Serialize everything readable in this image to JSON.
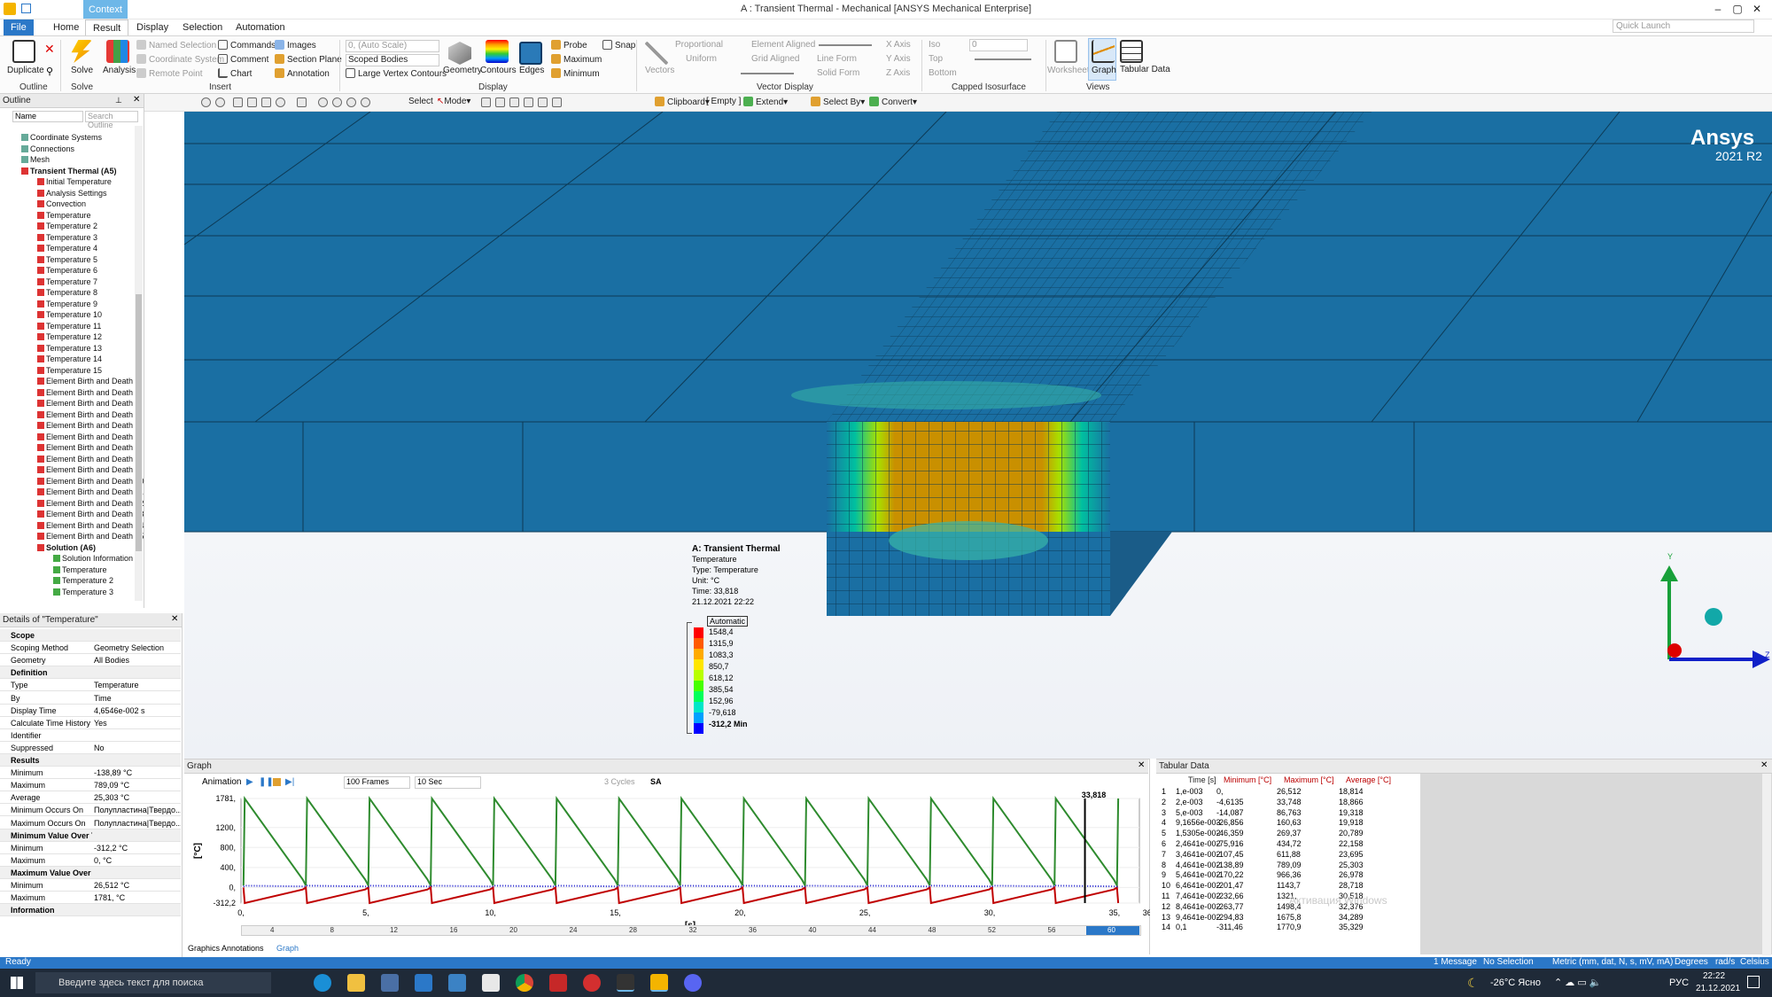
{
  "window": {
    "title": "A : Transient Thermal - Mechanical [ANSYS Mechanical Enterprise]",
    "context_tab": "Context",
    "quick_launch": "Quick Launch"
  },
  "ribbon": {
    "tabs": [
      "File",
      "Home",
      "Result",
      "Display",
      "Selection",
      "Automation"
    ],
    "groups": {
      "outline": "Outline",
      "solve": "Solve",
      "insert": "Insert",
      "display": "Display",
      "vector_display": "Vector Display",
      "capped_isosurface": "Capped Isosurface",
      "views": "Views"
    },
    "buttons": {
      "duplicate": "Duplicate",
      "solve": "Solve",
      "analysis": "Analysis",
      "named_selection": "Named Selection",
      "coordinate_system": "Coordinate System",
      "remote_point": "Remote Point",
      "commands": "Commands",
      "comment": "Comment",
      "chart": "Chart",
      "images": "Images",
      "section_plane": "Section Plane",
      "annotation": "Annotation",
      "auto_scale": "0, (Auto Scale)",
      "scoped_bodies": "Scoped Bodies",
      "large_vertex": "Large Vertex Contours",
      "geometry": "Geometry",
      "contours": "Contours",
      "edges": "Edges",
      "probe": "Probe",
      "maximum": "Maximum",
      "minimum": "Minimum",
      "snap": "Snap",
      "vectors": "Vectors",
      "proportional": "Proportional",
      "uniform": "Uniform",
      "element_aligned": "Element Aligned",
      "grid_aligned": "Grid Aligned",
      "line_form": "Line Form",
      "solid_form": "Solid Form",
      "x_axis": "X Axis",
      "y_axis": "Y Axis",
      "z_axis": "Z Axis",
      "iso": "Iso",
      "top": "Top",
      "bottom": "Bottom",
      "iso_value": "0",
      "worksheet": "Worksheet",
      "graph": "Graph",
      "tabular_data": "Tabular Data"
    }
  },
  "toolbar": {
    "select": "Select",
    "mode": "Mode",
    "clipboard": "Clipboard",
    "empty": "[ Empty ]",
    "extend": "Extend",
    "select_by": "Select By",
    "convert": "Convert"
  },
  "outline": {
    "title": "Outline",
    "filter_name": "Name",
    "search_placeholder": "Search Outline",
    "items": [
      {
        "label": "Coordinate Systems",
        "level": 1
      },
      {
        "label": "Connections",
        "level": 1
      },
      {
        "label": "Mesh",
        "level": 1
      },
      {
        "label": "Transient Thermal (A5)",
        "level": 1,
        "bold": true
      },
      {
        "label": "Initial Temperature",
        "level": 2
      },
      {
        "label": "Analysis Settings",
        "level": 2
      },
      {
        "label": "Convection",
        "level": 2
      },
      {
        "label": "Temperature",
        "level": 2
      },
      {
        "label": "Temperature 2",
        "level": 2
      },
      {
        "label": "Temperature 3",
        "level": 2
      },
      {
        "label": "Temperature 4",
        "level": 2
      },
      {
        "label": "Temperature 5",
        "level": 2
      },
      {
        "label": "Temperature 6",
        "level": 2
      },
      {
        "label": "Temperature 7",
        "level": 2
      },
      {
        "label": "Temperature 8",
        "level": 2
      },
      {
        "label": "Temperature 9",
        "level": 2
      },
      {
        "label": "Temperature 10",
        "level": 2
      },
      {
        "label": "Temperature 11",
        "level": 2
      },
      {
        "label": "Temperature 12",
        "level": 2
      },
      {
        "label": "Temperature 13",
        "level": 2
      },
      {
        "label": "Temperature 14",
        "level": 2
      },
      {
        "label": "Temperature 15",
        "level": 2
      },
      {
        "label": "Element Birth and Death",
        "level": 2
      },
      {
        "label": "Element Birth and Death 2",
        "level": 2
      },
      {
        "label": "Element Birth and Death 3",
        "level": 2
      },
      {
        "label": "Element Birth and Death 4",
        "level": 2
      },
      {
        "label": "Element Birth and Death 5",
        "level": 2
      },
      {
        "label": "Element Birth and Death 6",
        "level": 2
      },
      {
        "label": "Element Birth and Death 7",
        "level": 2
      },
      {
        "label": "Element Birth and Death 8",
        "level": 2
      },
      {
        "label": "Element Birth and Death 9",
        "level": 2
      },
      {
        "label": "Element Birth and Death 10",
        "level": 2
      },
      {
        "label": "Element Birth and Death 11",
        "level": 2
      },
      {
        "label": "Element Birth and Death 12",
        "level": 2
      },
      {
        "label": "Element Birth and Death 13",
        "level": 2
      },
      {
        "label": "Element Birth and Death 14",
        "level": 2
      },
      {
        "label": "Element Birth and Death 15",
        "level": 2
      },
      {
        "label": "Solution (A6)",
        "level": 2,
        "bold": true
      },
      {
        "label": "Solution Information",
        "level": 3
      },
      {
        "label": "Temperature",
        "level": 3
      },
      {
        "label": "Temperature 2",
        "level": 3
      },
      {
        "label": "Temperature 3",
        "level": 3
      }
    ]
  },
  "details": {
    "title": "Details of \"Temperature\"",
    "rows": [
      {
        "k": "Scope",
        "section": true
      },
      {
        "k": "Scoping Method",
        "v": "Geometry Selection"
      },
      {
        "k": "Geometry",
        "v": "All Bodies"
      },
      {
        "k": "Definition",
        "section": true
      },
      {
        "k": "Type",
        "v": "Temperature"
      },
      {
        "k": "By",
        "v": "Time"
      },
      {
        "k": "Display Time",
        "v": "4,6546e-002 s"
      },
      {
        "k": "Calculate Time History",
        "v": "Yes"
      },
      {
        "k": "Identifier",
        "v": ""
      },
      {
        "k": "Suppressed",
        "v": "No"
      },
      {
        "k": "Results",
        "section": true
      },
      {
        "k": "Minimum",
        "v": "-138,89 °C"
      },
      {
        "k": "Maximum",
        "v": "789,09 °C"
      },
      {
        "k": "Average",
        "v": "25,303 °C"
      },
      {
        "k": "Minimum Occurs On",
        "v": "Полупластина|Твердо..."
      },
      {
        "k": "Maximum Occurs On",
        "v": "Полупластина|Твердо..."
      },
      {
        "k": "Minimum Value Over Time",
        "section": true
      },
      {
        "k": "Minimum",
        "v": "-312,2 °C"
      },
      {
        "k": "Maximum",
        "v": "0, °C"
      },
      {
        "k": "Maximum Value Over Time",
        "section": true
      },
      {
        "k": "Minimum",
        "v": "26,512 °C"
      },
      {
        "k": "Maximum",
        "v": "1781, °C"
      },
      {
        "k": "Information",
        "section": true
      }
    ]
  },
  "viewport": {
    "brand": "Ansys",
    "version": "2021 R2",
    "result_title": "A: Transient Thermal",
    "result_lines": [
      "Temperature",
      "Type: Temperature",
      "Unit: °C",
      "Time: 33,818",
      "21.12.2021 22:22"
    ],
    "legend_header": "Automatic",
    "legend_values": [
      "1548,4",
      "1315,9",
      "1083,3",
      "850,7",
      "618,12",
      "385,54",
      "152,96",
      "-79,618"
    ],
    "legend_min": "-312,2 Min",
    "legend_colors": [
      "#ff0000",
      "#ff5a00",
      "#ffaa00",
      "#ffe600",
      "#b8ff00",
      "#46ff00",
      "#00ff5a",
      "#00e6c8",
      "#00a0ff",
      "#0000ff"
    ],
    "triad": {
      "y": "Y",
      "z": "Z"
    }
  },
  "graph_panel": {
    "title": "Graph",
    "animation": "Animation",
    "frames": "100 Frames",
    "duration": "10 Sec",
    "cycles": "3 Cycles",
    "sa": "SA",
    "tabs": [
      "Graphics Annotations",
      "Graph"
    ],
    "timeline_labels": [
      "4",
      "8",
      "12",
      "16",
      "20",
      "24",
      "28",
      "32",
      "36",
      "40",
      "44",
      "48",
      "52",
      "56",
      "60"
    ]
  },
  "chart_data": {
    "type": "line",
    "title": "",
    "xlabel": "[s]",
    "ylabel": "[°C]",
    "ylim": [
      -312.2,
      1781
    ],
    "yticks": [
      "1781,",
      "1200,",
      "800,",
      "400,",
      "0,",
      "-312,2"
    ],
    "xlim": [
      0,
      36
    ],
    "xticks": [
      "0,",
      "5,",
      "10,",
      "15,",
      "20,",
      "25,",
      "30,",
      "35,",
      "36,"
    ],
    "marker_time": 33.818,
    "marker_label": "33,818",
    "series": [
      {
        "name": "Maximum",
        "color": "#2e8b2e",
        "period": 2.5,
        "peak": 1781,
        "low": 40
      },
      {
        "name": "Minimum",
        "color": "#c00000",
        "period": 2.5,
        "peak": 0,
        "low": -312.2
      },
      {
        "name": "Average",
        "color": "#1a1acc",
        "period": 2.5,
        "peak": 36,
        "low": 18
      }
    ]
  },
  "tabular": {
    "title": "Tabular Data",
    "headers": [
      "Time [s]",
      "Minimum [°C]",
      "Maximum [°C]",
      "Average [°C]"
    ],
    "rows": [
      [
        "1",
        "1,e-003",
        "0,",
        "26,512",
        "18,814"
      ],
      [
        "2",
        "2,e-003",
        "-4,6135",
        "33,748",
        "18,866"
      ],
      [
        "3",
        "5,e-003",
        "-14,087",
        "86,763",
        "19,318"
      ],
      [
        "4",
        "9,1656e-003",
        "-26,856",
        "160,63",
        "19,918"
      ],
      [
        "5",
        "1,5305e-002",
        "-46,359",
        "269,37",
        "20,789"
      ],
      [
        "6",
        "2,4641e-002",
        "-75,916",
        "434,72",
        "22,158"
      ],
      [
        "7",
        "3,4641e-002",
        "-107,45",
        "611,88",
        "23,695"
      ],
      [
        "8",
        "4,4641e-002",
        "-138,89",
        "789,09",
        "25,303"
      ],
      [
        "9",
        "5,4641e-002",
        "-170,22",
        "966,36",
        "26,978"
      ],
      [
        "10",
        "6,4641e-002",
        "-201,47",
        "1143,7",
        "28,718"
      ],
      [
        "11",
        "7,4641e-002",
        "-232,66",
        "1321,",
        "30,518"
      ],
      [
        "12",
        "8,4641e-002",
        "-263,77",
        "1498,4",
        "32,376"
      ],
      [
        "13",
        "9,4641e-002",
        "-294,83",
        "1675,8",
        "34,289"
      ],
      [
        "14",
        "0,1",
        "-311,46",
        "1770,9",
        "35,329"
      ]
    ],
    "watermark": "Активация Windows"
  },
  "status": {
    "ready": "Ready",
    "messages": "1 Message",
    "selection": "No Selection",
    "units": "Metric (mm, dat, N, s, mV, mA)",
    "degrees": "Degrees",
    "rads": "rad/s",
    "celsius": "Celsius"
  },
  "taskbar": {
    "search": "Введите здесь текст для поиска",
    "weather": "-26°C Ясно",
    "lang": "РУС",
    "time": "22:22",
    "date": "21.12.2021"
  }
}
